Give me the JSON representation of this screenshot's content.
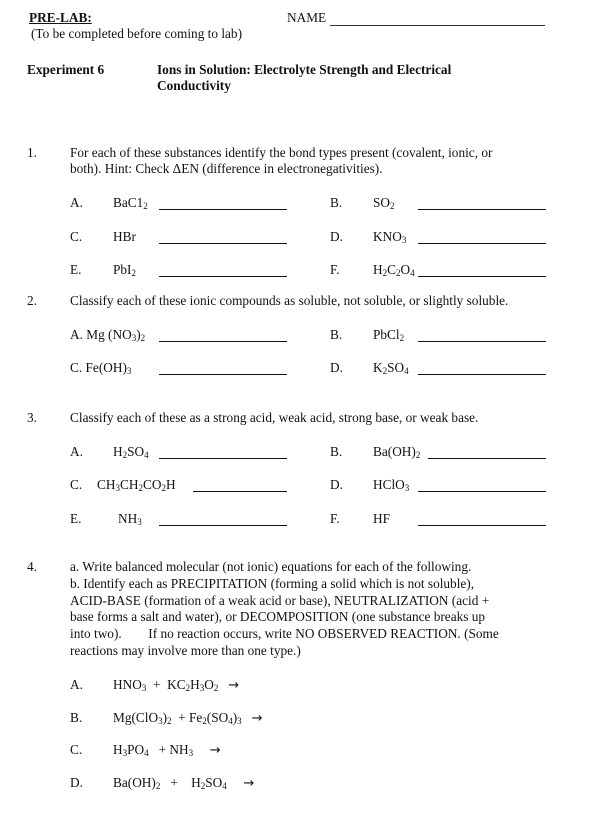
{
  "header": {
    "prelab_label": "PRE-LAB:",
    "subtitle": "(To be completed before coming to lab)",
    "name_label": "NAME"
  },
  "experiment": {
    "label": "Experiment 6",
    "title_line1": "Ions in Solution: Electrolyte Strength and Electrical",
    "title_line2": "Conductivity"
  },
  "questions": [
    {
      "number": "1.",
      "text_line1": "For each of these substances identify the bond types present (covalent, ionic, or",
      "text_line2": "both). Hint: Check ΔEN (difference in electronegativities).",
      "items": [
        {
          "letter": "A.",
          "formula": "BaC1<sub>2</sub>"
        },
        {
          "letter": "B.",
          "formula": "SO<sub>2</sub>"
        },
        {
          "letter": "C.",
          "formula": "HBr"
        },
        {
          "letter": "D.",
          "formula": "KNO<sub>3</sub>"
        },
        {
          "letter": "E.",
          "formula": "PbI<sub>2</sub>"
        },
        {
          "letter": "F.",
          "formula": "H<sub>2</sub>C<sub>2</sub>O<sub>4</sub>"
        }
      ]
    },
    {
      "number": "2.",
      "text_line1": "Classify each of these ionic compounds as soluble, not soluble, or slightly soluble.",
      "items": [
        {
          "letter": "A.",
          "formula": "Mg (NO<sub>3</sub>)<sub>2</sub>"
        },
        {
          "letter": "B.",
          "formula": "PbCl<sub>2</sub>"
        },
        {
          "letter": "C.",
          "formula": "Fe(OH)<sub>3</sub>"
        },
        {
          "letter": "D.",
          "formula": "K<sub>2</sub>SO<sub>4</sub>"
        }
      ]
    },
    {
      "number": "3.",
      "text_line1": "Classify each of these as a strong acid, weak acid, strong base, or weak base.",
      "items": [
        {
          "letter": "A.",
          "formula": "H<sub>2</sub>SO<sub>4</sub>"
        },
        {
          "letter": "B.",
          "formula": "Ba(OH)<sub>2</sub>"
        },
        {
          "letter": "C.",
          "formula": "CH<sub>3</sub>CH<sub>2</sub>CO<sub>2</sub>H"
        },
        {
          "letter": "D.",
          "formula": "HClO<sub>3</sub>"
        },
        {
          "letter": "E.",
          "formula": "NH<sub>3</sub>"
        },
        {
          "letter": "F.",
          "formula": "HF"
        }
      ]
    },
    {
      "number": "4.",
      "lines": [
        "a. Write balanced molecular (not ionic) equations for each of the following.",
        "b. Identify each as PRECIPITATION (forming a solid which is not soluble),",
        "ACID-BASE (formation of a weak acid or base), NEUTRALIZATION (acid +",
        "base forms a salt and water), or DECOMPOSITION (one substance breaks up",
        "into two).        If no reaction occurs, write NO OBSERVED REACTION. (Some",
        "reactions may involve more than one type.)"
      ],
      "reactions": [
        {
          "letter": "A.",
          "equation": "HNO<sub>3</sub> &nbsp;+&nbsp; KC<sub>2</sub>H<sub>3</sub>O<sub>2</sub>",
          "arrow": "→"
        },
        {
          "letter": "B.",
          "equation": "Mg(ClO<sub>3</sub>)<sub>2</sub> &nbsp;+ Fe<sub>2</sub>(SO<sub>4</sub>)<sub>3</sub>",
          "arrow": "→"
        },
        {
          "letter": "C.",
          "equation": "H<sub>3</sub>PO<sub>4</sub> &nbsp;&nbsp;+ NH<sub>3</sub>",
          "arrow": "→"
        },
        {
          "letter": "D.",
          "equation": "Ba(OH)<sub>2</sub> &nbsp;&nbsp;+ &nbsp;&nbsp;&nbsp;H<sub>2</sub>SO<sub>4</sub>",
          "arrow": "→"
        }
      ]
    }
  ]
}
